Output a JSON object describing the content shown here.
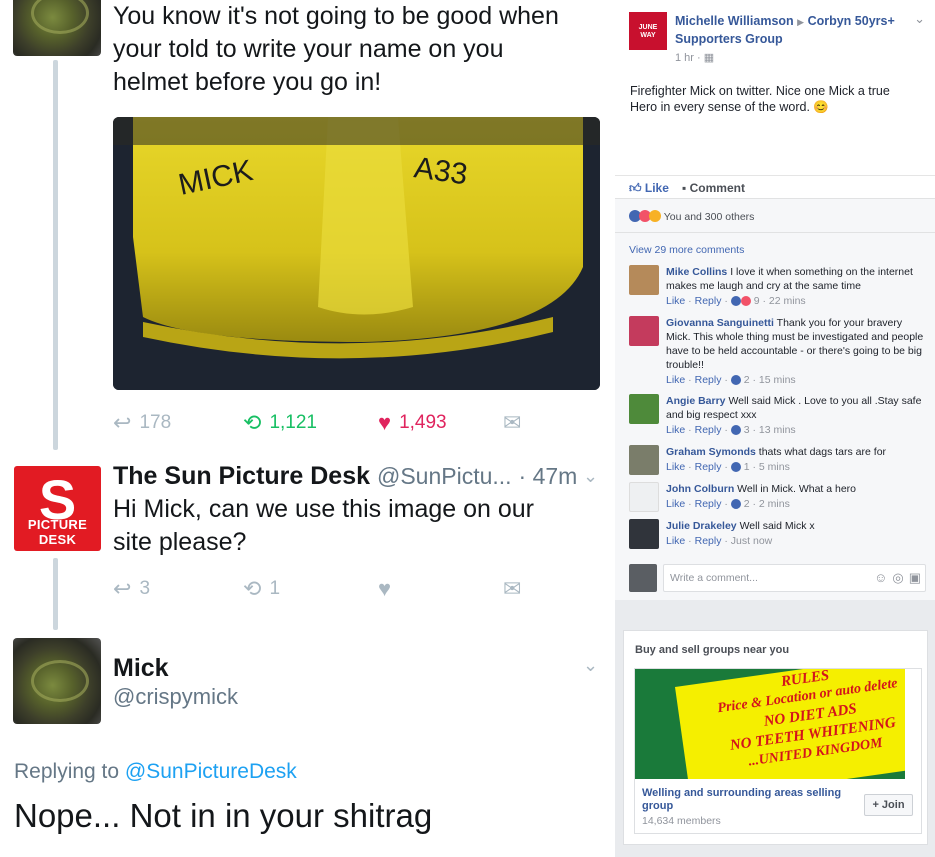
{
  "twitter": {
    "tweet1": {
      "text_lines": [
        "You know it's not going to be good when",
        "your told to write your name on you",
        "helmet before you go in!"
      ],
      "helmet_writing_left": "MICK",
      "helmet_writing_right": "A33",
      "replies": "178",
      "retweets": "1,121",
      "likes": "1,493"
    },
    "tweet2": {
      "logo_letter": "S",
      "logo_text": "PICTURE DESK",
      "name": "The Sun Picture Desk",
      "handle": "@SunPictu...",
      "time": "· 47m",
      "text_lines": [
        "Hi Mick, can we use this image on our",
        "site please?"
      ],
      "replies": "3",
      "retweets": "1"
    },
    "tweet3": {
      "name": "Mick",
      "handle": "@crispymick",
      "replying_prefix": "Replying to",
      "replying_to": "@SunPictureDesk",
      "text": "Nope... Not in in your shitrag"
    }
  },
  "facebook": {
    "post": {
      "author": "Michelle Williamson",
      "group": "Corbyn 50yrs+",
      "group_line2": "Supporters Group",
      "time": "1 hr ·",
      "body": "Firefighter Mick on twitter. Nice one Mick a true Hero in every sense of the word. 😊",
      "like_label": "Like",
      "comment_label": "Comment",
      "reactions_text": "You and 300 others",
      "view_more": "View 29 more comments"
    },
    "comments": [
      {
        "name": "Mike Collins",
        "text": "I love it when something on the internet makes me laugh and cry at the same time",
        "meta_like": "Like",
        "meta_reply": "Reply",
        "count": "9",
        "time": "· 22 mins"
      },
      {
        "name": "Giovanna Sanguinetti",
        "text": "Thank you for your bravery Mick. This whole thing must be investigated and people have to be held accountable - or there's going to be big trouble!!",
        "meta_like": "Like",
        "meta_reply": "Reply",
        "count": "2",
        "time": "· 15 mins"
      },
      {
        "name": "Angie Barry",
        "text": "Well said Mick . Love to you all .Stay safe and big respect xxx",
        "meta_like": "Like",
        "meta_reply": "Reply",
        "count": "3",
        "time": "· 13 mins"
      },
      {
        "name": "Graham Symonds",
        "text": "thats what dags tars are for",
        "meta_like": "Like",
        "meta_reply": "Reply",
        "count": "1",
        "time": "· 5 mins"
      },
      {
        "name": "John Colburn",
        "text": "Well in Mick. What a hero",
        "meta_like": "Like",
        "meta_reply": "Reply",
        "count": "2",
        "time": "· 2 mins"
      },
      {
        "name": "Julie Drakeley",
        "text": "Well said Mick x",
        "meta_like": "Like",
        "meta_reply": "Reply",
        "count": "",
        "time": "· Just now"
      }
    ],
    "write_placeholder": "Write a comment...",
    "groups": {
      "title": "Buy and sell groups near you",
      "rules_lines": [
        "RULES",
        "Price & Location or auto delete",
        "NO DIET ADS",
        "NO TEETH WHITENING",
        "...UNITED KINGDOM"
      ],
      "group_name": "Welling and surrounding areas selling group",
      "members": "14,634 members",
      "join_label": "+ Join"
    }
  },
  "colors": {
    "twitter_blue": "#1da1f2",
    "retweet_green": "#17bf63",
    "like_red": "#e0245e",
    "fb_link": "#365899",
    "sun_red": "#e21b23"
  }
}
